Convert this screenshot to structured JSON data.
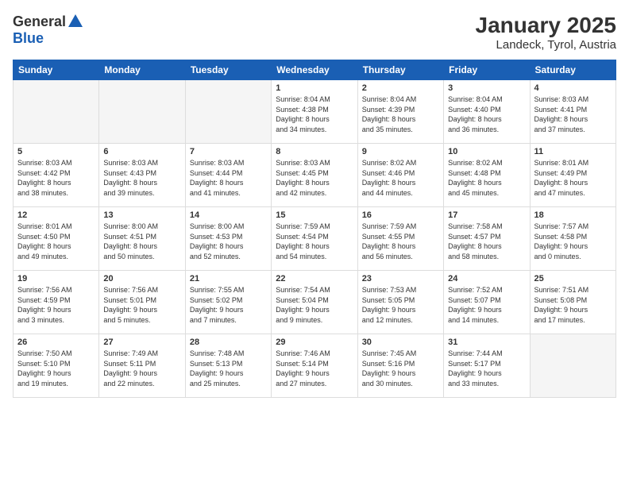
{
  "logo": {
    "general": "General",
    "blue": "Blue"
  },
  "title": "January 2025",
  "subtitle": "Landeck, Tyrol, Austria",
  "headers": [
    "Sunday",
    "Monday",
    "Tuesday",
    "Wednesday",
    "Thursday",
    "Friday",
    "Saturday"
  ],
  "rows": [
    [
      {
        "day": "",
        "info": "",
        "empty": true
      },
      {
        "day": "",
        "info": "",
        "empty": true
      },
      {
        "day": "",
        "info": "",
        "empty": true
      },
      {
        "day": "1",
        "info": "Sunrise: 8:04 AM\nSunset: 4:38 PM\nDaylight: 8 hours\nand 34 minutes."
      },
      {
        "day": "2",
        "info": "Sunrise: 8:04 AM\nSunset: 4:39 PM\nDaylight: 8 hours\nand 35 minutes."
      },
      {
        "day": "3",
        "info": "Sunrise: 8:04 AM\nSunset: 4:40 PM\nDaylight: 8 hours\nand 36 minutes."
      },
      {
        "day": "4",
        "info": "Sunrise: 8:03 AM\nSunset: 4:41 PM\nDaylight: 8 hours\nand 37 minutes."
      }
    ],
    [
      {
        "day": "5",
        "info": "Sunrise: 8:03 AM\nSunset: 4:42 PM\nDaylight: 8 hours\nand 38 minutes."
      },
      {
        "day": "6",
        "info": "Sunrise: 8:03 AM\nSunset: 4:43 PM\nDaylight: 8 hours\nand 39 minutes."
      },
      {
        "day": "7",
        "info": "Sunrise: 8:03 AM\nSunset: 4:44 PM\nDaylight: 8 hours\nand 41 minutes."
      },
      {
        "day": "8",
        "info": "Sunrise: 8:03 AM\nSunset: 4:45 PM\nDaylight: 8 hours\nand 42 minutes."
      },
      {
        "day": "9",
        "info": "Sunrise: 8:02 AM\nSunset: 4:46 PM\nDaylight: 8 hours\nand 44 minutes."
      },
      {
        "day": "10",
        "info": "Sunrise: 8:02 AM\nSunset: 4:48 PM\nDaylight: 8 hours\nand 45 minutes."
      },
      {
        "day": "11",
        "info": "Sunrise: 8:01 AM\nSunset: 4:49 PM\nDaylight: 8 hours\nand 47 minutes."
      }
    ],
    [
      {
        "day": "12",
        "info": "Sunrise: 8:01 AM\nSunset: 4:50 PM\nDaylight: 8 hours\nand 49 minutes."
      },
      {
        "day": "13",
        "info": "Sunrise: 8:00 AM\nSunset: 4:51 PM\nDaylight: 8 hours\nand 50 minutes."
      },
      {
        "day": "14",
        "info": "Sunrise: 8:00 AM\nSunset: 4:53 PM\nDaylight: 8 hours\nand 52 minutes."
      },
      {
        "day": "15",
        "info": "Sunrise: 7:59 AM\nSunset: 4:54 PM\nDaylight: 8 hours\nand 54 minutes."
      },
      {
        "day": "16",
        "info": "Sunrise: 7:59 AM\nSunset: 4:55 PM\nDaylight: 8 hours\nand 56 minutes."
      },
      {
        "day": "17",
        "info": "Sunrise: 7:58 AM\nSunset: 4:57 PM\nDaylight: 8 hours\nand 58 minutes."
      },
      {
        "day": "18",
        "info": "Sunrise: 7:57 AM\nSunset: 4:58 PM\nDaylight: 9 hours\nand 0 minutes."
      }
    ],
    [
      {
        "day": "19",
        "info": "Sunrise: 7:56 AM\nSunset: 4:59 PM\nDaylight: 9 hours\nand 3 minutes."
      },
      {
        "day": "20",
        "info": "Sunrise: 7:56 AM\nSunset: 5:01 PM\nDaylight: 9 hours\nand 5 minutes."
      },
      {
        "day": "21",
        "info": "Sunrise: 7:55 AM\nSunset: 5:02 PM\nDaylight: 9 hours\nand 7 minutes."
      },
      {
        "day": "22",
        "info": "Sunrise: 7:54 AM\nSunset: 5:04 PM\nDaylight: 9 hours\nand 9 minutes."
      },
      {
        "day": "23",
        "info": "Sunrise: 7:53 AM\nSunset: 5:05 PM\nDaylight: 9 hours\nand 12 minutes."
      },
      {
        "day": "24",
        "info": "Sunrise: 7:52 AM\nSunset: 5:07 PM\nDaylight: 9 hours\nand 14 minutes."
      },
      {
        "day": "25",
        "info": "Sunrise: 7:51 AM\nSunset: 5:08 PM\nDaylight: 9 hours\nand 17 minutes."
      }
    ],
    [
      {
        "day": "26",
        "info": "Sunrise: 7:50 AM\nSunset: 5:10 PM\nDaylight: 9 hours\nand 19 minutes."
      },
      {
        "day": "27",
        "info": "Sunrise: 7:49 AM\nSunset: 5:11 PM\nDaylight: 9 hours\nand 22 minutes."
      },
      {
        "day": "28",
        "info": "Sunrise: 7:48 AM\nSunset: 5:13 PM\nDaylight: 9 hours\nand 25 minutes."
      },
      {
        "day": "29",
        "info": "Sunrise: 7:46 AM\nSunset: 5:14 PM\nDaylight: 9 hours\nand 27 minutes."
      },
      {
        "day": "30",
        "info": "Sunrise: 7:45 AM\nSunset: 5:16 PM\nDaylight: 9 hours\nand 30 minutes."
      },
      {
        "day": "31",
        "info": "Sunrise: 7:44 AM\nSunset: 5:17 PM\nDaylight: 9 hours\nand 33 minutes."
      },
      {
        "day": "",
        "info": "",
        "empty": true
      }
    ]
  ]
}
